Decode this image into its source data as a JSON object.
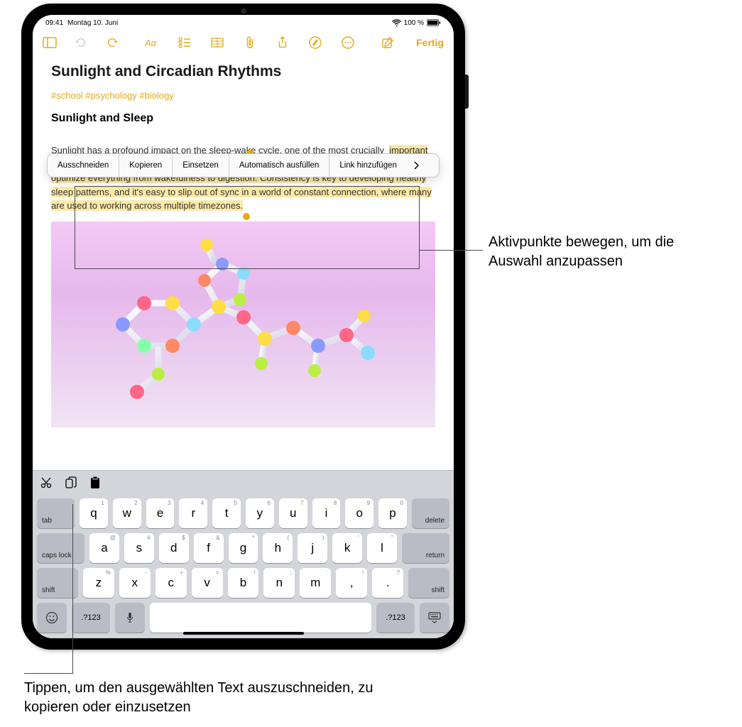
{
  "status": {
    "time": "09:41",
    "date": "Montag 10. Juni",
    "battery": "100 %"
  },
  "toolbar": {
    "done": "Fertig"
  },
  "context_menu": {
    "cut": "Ausschneiden",
    "copy": "Kopieren",
    "paste": "Einsetzen",
    "autofill": "Automatisch ausfüllen",
    "addlink": "Link hinzufügen"
  },
  "note": {
    "title": "Sunlight and Circadian Rhythms",
    "tags": "#school #psychology #biology",
    "heading": "Sunlight and Sleep",
    "first_line": "Sunlight has a profound impact on the sleep-wake cycle, one of the most crucially",
    "selected": "important of our circadian rhythms-a series of cyclical processes that help time our bodies' functions to optimize everything from wakefulness to digestion. Consistency is key to developing healthy sleep patterns, and it's easy to slip out of sync in a world of constant connection, where many are used to working across multiple timezones."
  },
  "keyboard": {
    "tab": "tab",
    "delete": "delete",
    "caps": "caps lock",
    "return": "return",
    "shift": "shift",
    "symnum": ".?123",
    "row1": [
      {
        "k": "q",
        "s": "1"
      },
      {
        "k": "w",
        "s": "2"
      },
      {
        "k": "e",
        "s": "3"
      },
      {
        "k": "r",
        "s": "4"
      },
      {
        "k": "t",
        "s": "5"
      },
      {
        "k": "y",
        "s": "6"
      },
      {
        "k": "u",
        "s": "7"
      },
      {
        "k": "i",
        "s": "8"
      },
      {
        "k": "o",
        "s": "9"
      },
      {
        "k": "p",
        "s": "0"
      }
    ],
    "row2": [
      {
        "k": "a",
        "s": "@"
      },
      {
        "k": "s",
        "s": "#"
      },
      {
        "k": "d",
        "s": "$"
      },
      {
        "k": "f",
        "s": "&"
      },
      {
        "k": "g",
        "s": "*"
      },
      {
        "k": "h",
        "s": "("
      },
      {
        "k": "j",
        "s": ")"
      },
      {
        "k": "k",
        "s": "'"
      },
      {
        "k": "l",
        "s": "\""
      }
    ],
    "row3": [
      {
        "k": "z",
        "s": "%"
      },
      {
        "k": "x",
        "s": "-"
      },
      {
        "k": "c",
        "s": "+"
      },
      {
        "k": "v",
        "s": "="
      },
      {
        "k": "b",
        "s": "/"
      },
      {
        "k": "n",
        "s": ";"
      },
      {
        "k": "m",
        "s": ":"
      },
      {
        "k": ",",
        "s": "!"
      },
      {
        "k": ".",
        "s": "?"
      }
    ]
  },
  "callouts": {
    "handles": "Aktivpunkte bewegen, um die Auswahl anzupassen",
    "cutcopy": "Tippen, um den ausgewählten Text auszuschneiden, zu kopieren oder einzusetzen"
  }
}
